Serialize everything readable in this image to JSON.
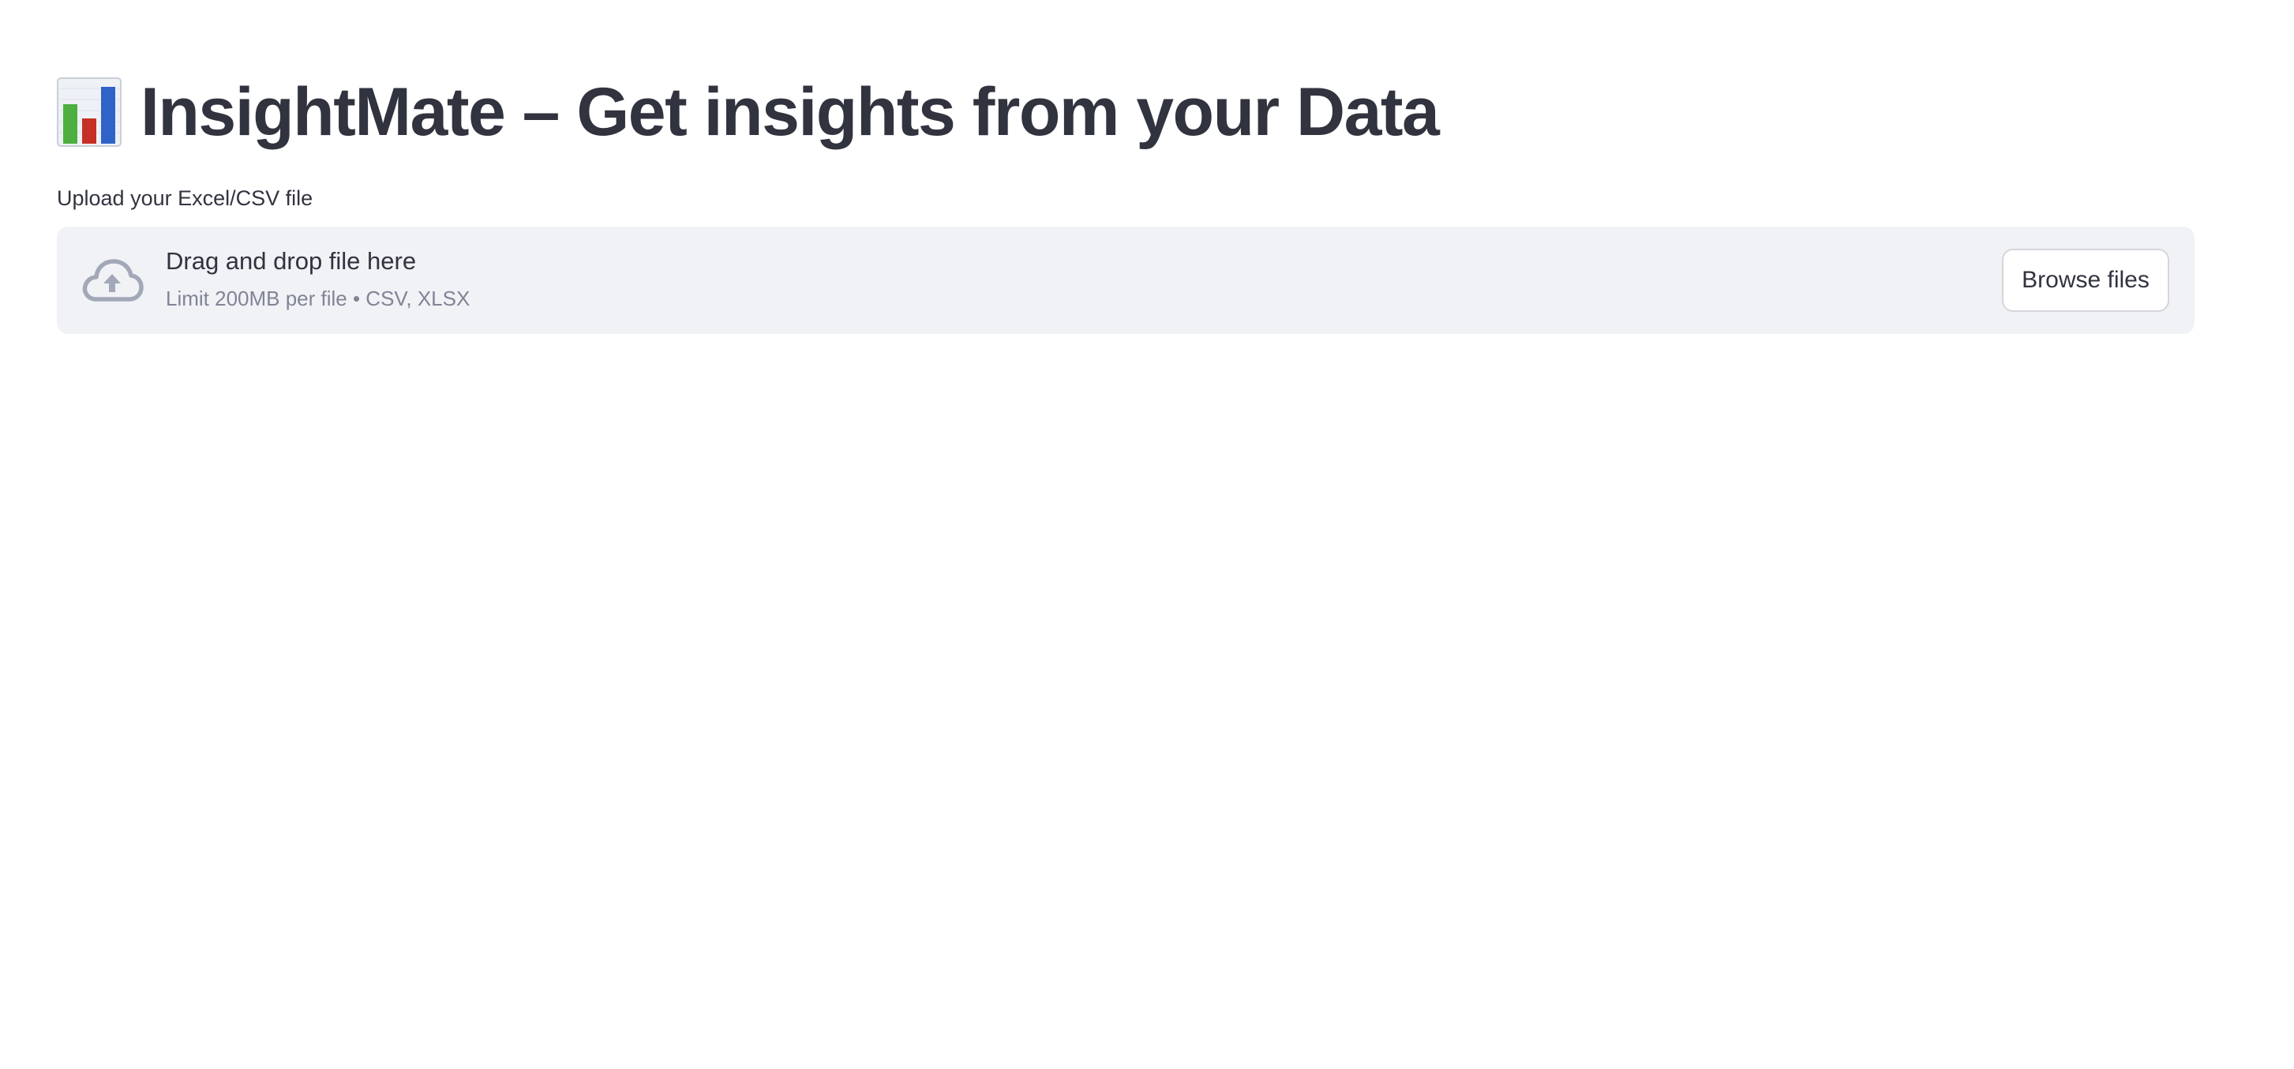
{
  "header": {
    "emoji_icon": "bar-chart-emoji",
    "title": "InsightMate – Get insights from your Data"
  },
  "uploader": {
    "label": "Upload your Excel/CSV file",
    "drop_text": "Drag and drop file here",
    "limit_text": "Limit 200MB per file • CSV, XLSX",
    "icon": "cloud-upload-icon",
    "browse_label": "Browse files"
  },
  "colors": {
    "text": "#31333f",
    "muted_text": "#808495",
    "dropzone_bg": "#f0f2f6",
    "icon": "#a3a8b8"
  }
}
